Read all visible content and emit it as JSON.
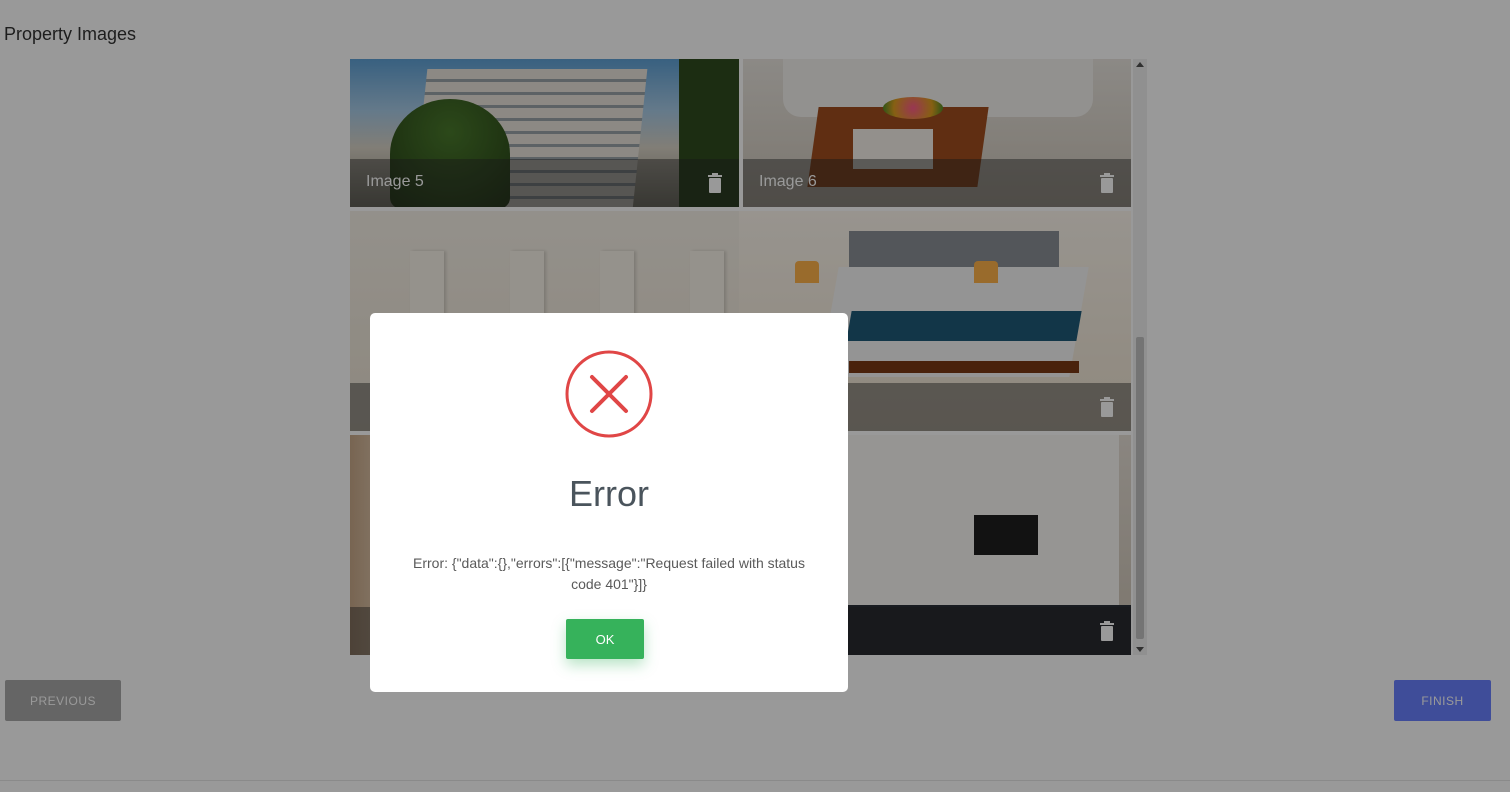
{
  "section": {
    "title": "Property Images"
  },
  "gallery": {
    "tiles": [
      {
        "label": "Image 5"
      },
      {
        "label": "Image 6"
      },
      {
        "label": ""
      },
      {
        "label": ""
      },
      {
        "label": ""
      },
      {
        "label": ""
      }
    ]
  },
  "nav": {
    "previous_label": "PREVIOUS",
    "finish_label": "FINISH"
  },
  "dialog": {
    "title": "Error",
    "message": "Error: {\"data\":{},\"errors\":[{\"message\":\"Request failed with status code 401\"}]}",
    "ok_label": "OK",
    "icon": "error-x-icon",
    "icon_color": "#e04646"
  },
  "colors": {
    "finish": "#6a80ff",
    "ok": "#36b25b",
    "previous": "#a8a8a8"
  }
}
